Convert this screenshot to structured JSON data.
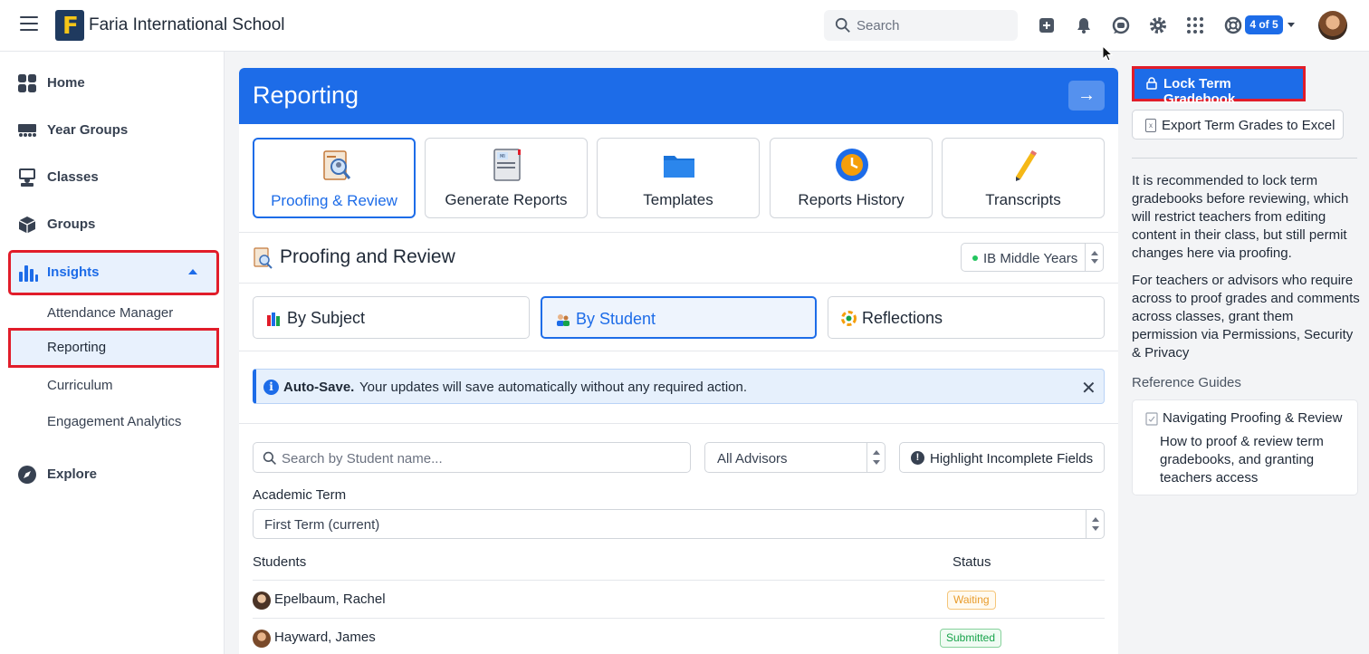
{
  "header": {
    "school_name": "Faria International School",
    "logo_letter": "F",
    "search_placeholder": "Search",
    "switcher_badge": "4 of 5"
  },
  "sidebar": {
    "items": [
      {
        "label": "Home",
        "icon": "grid-icon"
      },
      {
        "label": "Year Groups",
        "icon": "people-row-icon"
      },
      {
        "label": "Classes",
        "icon": "classroom-icon"
      },
      {
        "label": "Groups",
        "icon": "cube-icon"
      },
      {
        "label": "Insights",
        "icon": "bar-chart-icon"
      },
      {
        "label": "Explore",
        "icon": "compass-icon"
      }
    ],
    "insights_sub": [
      "Attendance Manager",
      "Reporting",
      "Curriculum",
      "Engagement Analytics"
    ]
  },
  "main": {
    "title": "Reporting",
    "tiles": [
      "Proofing & Review",
      "Generate Reports",
      "Templates",
      "Reports History",
      "Transcripts"
    ],
    "section_title": "Proofing and Review",
    "program_select": "IB Middle Years",
    "segments": [
      "By Subject",
      "By Student",
      "Reflections"
    ],
    "alert": {
      "bold": "Auto-Save.",
      "message": "Your updates will save automatically without any required action."
    },
    "student_search_placeholder": "Search by Student name...",
    "advisors_select": "All Advisors",
    "highlight_button": "Highlight Incomplete Fields",
    "term_label": "Academic Term",
    "term_select": "First Term (current)",
    "table": {
      "headers": [
        "Students",
        "Status"
      ],
      "rows": [
        {
          "name": "Epelbaum, Rachel",
          "status": "Waiting"
        },
        {
          "name": "Hayward, James",
          "status": "Submitted"
        }
      ]
    }
  },
  "right_panel": {
    "lock_button": "Lock Term Gradebook",
    "export_button": "Export Term Grades to Excel",
    "para1": "It is recommended to lock term gradebooks before reviewing, which will restrict teachers from editing content in their class, but still permit changes here via proofing.",
    "para2": "For teachers or advisors who require across to proof grades and comments across classes, grant them permission via Permissions, Security & Privacy",
    "reference_title": "Reference Guides",
    "guide_title": "Navigating Proofing & Review",
    "guide_desc": "How to proof & review term gradebooks, and granting teachers access"
  },
  "colors": {
    "accent": "#1d6ce8",
    "highlight_outline": "#e11d2a",
    "waiting": "#e89b2a",
    "submitted": "#16a34a"
  }
}
